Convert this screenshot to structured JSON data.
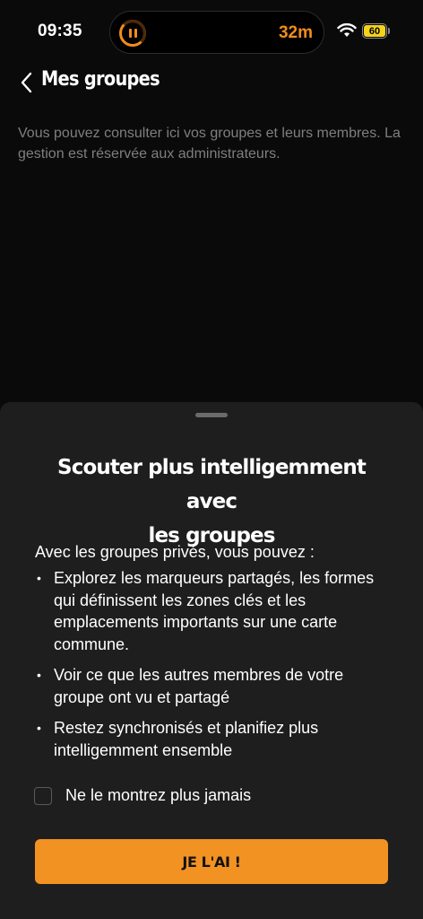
{
  "status_bar": {
    "time": "09:35",
    "activity_label": "32m",
    "battery": "60",
    "accent_color": "#f28c1c",
    "battery_color": "#f5d31b"
  },
  "nav": {
    "title": "Mes groupes",
    "back_icon": "chevron-left-icon"
  },
  "intro_text": "Vous pouvez consulter ici vos groupes et leurs membres. La gestion est réservée aux administrateurs.",
  "sheet": {
    "title_line1": "Scouter plus intelligemment avec",
    "title_line2": "les groupes",
    "lead": "Avec les groupes privés, vous pouvez :",
    "bullets": [
      "Explorez les marqueurs partagés, les formes qui définissent les zones clés et les emplacements importants sur une carte commune.",
      "Voir ce que les autres membres de votre groupe ont vu et partagé",
      "Restez synchronisés et planifiez plus intelligemment ensemble"
    ],
    "bullet_symbol": "•",
    "checkbox_label": "Ne le montrez plus jamais",
    "checkbox_checked": false,
    "cta_label": "JE L'AI !",
    "cta_color": "#f29222"
  }
}
